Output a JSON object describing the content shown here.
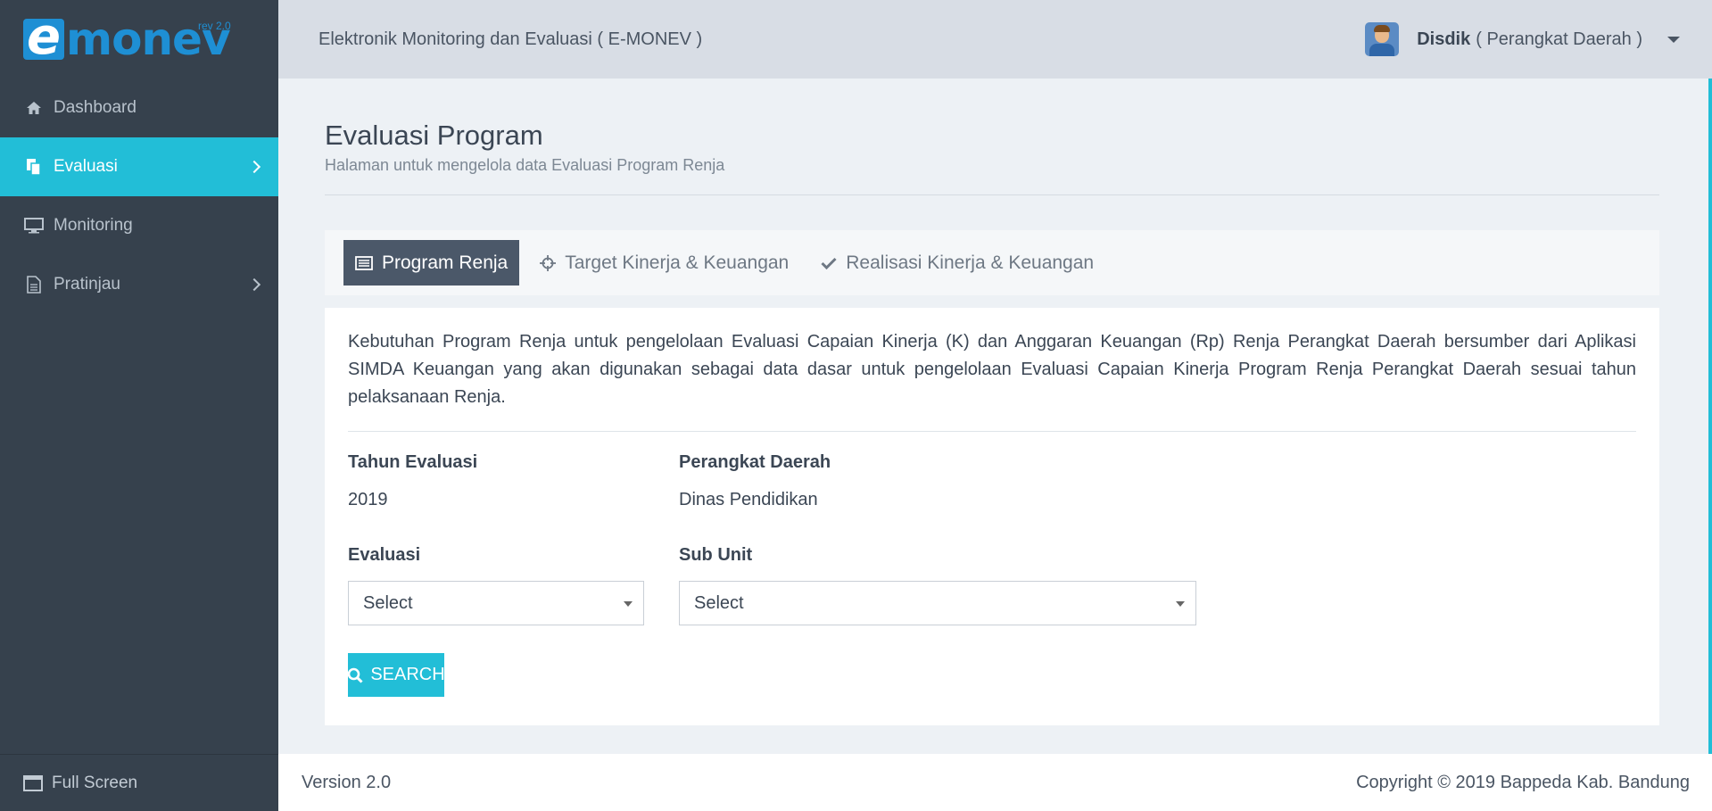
{
  "brand": {
    "logo_letter": "e",
    "logo_text": "monev",
    "logo_rev": "rev 2.0"
  },
  "header": {
    "title": "Elektronik Monitoring dan Evaluasi ( E-MONEV )",
    "user_name": "Disdik",
    "user_role": "( Perangkat Daerah )"
  },
  "sidebar": {
    "items": [
      {
        "label": "Dashboard",
        "icon": "home-icon"
      },
      {
        "label": "Evaluasi",
        "icon": "copy-icon",
        "active": true
      },
      {
        "label": "Monitoring",
        "icon": "monitor-icon"
      },
      {
        "label": "Pratinjau",
        "icon": "file-icon"
      }
    ],
    "fullscreen_label": "Full Screen"
  },
  "page": {
    "title": "Evaluasi Program",
    "subtitle": "Halaman untuk mengelola data Evaluasi Program Renja"
  },
  "tabs": [
    {
      "label": "Program Renja",
      "icon": "list-icon",
      "active": true
    },
    {
      "label": "Target Kinerja & Keuangan",
      "icon": "crosshair-icon"
    },
    {
      "label": "Realisasi Kinerja & Keuangan",
      "icon": "check-icon"
    }
  ],
  "card": {
    "description": "Kebutuhan Program Renja untuk pengelolaan Evaluasi Capaian Kinerja (K) dan Anggaran Keuangan (Rp) Renja Perangkat Daerah bersumber dari Aplikasi SIMDA Keuangan yang akan digunakan sebagai data dasar untuk pengelolaan Evaluasi Capaian Kinerja Program Renja Perangkat Daerah sesuai tahun pelaksanaan Renja.",
    "tahun_label": "Tahun Evaluasi",
    "tahun_value": "2019",
    "perangkat_label": "Perangkat Daerah",
    "perangkat_value": "Dinas Pendidikan",
    "evaluasi_label": "Evaluasi",
    "evaluasi_selected": "Select",
    "subunit_label": "Sub Unit",
    "subunit_selected": "Select",
    "search_label": "SEARCH"
  },
  "footer": {
    "version": "Version 2.0",
    "copyright": "Copyright © 2019 Bappeda Kab. Bandung"
  },
  "colors": {
    "sidebar_bg": "#36414d",
    "accent": "#22bed7",
    "topbar_bg": "#d8dde5",
    "active_tab": "#4b5869",
    "brand": "#1e8fd4"
  }
}
